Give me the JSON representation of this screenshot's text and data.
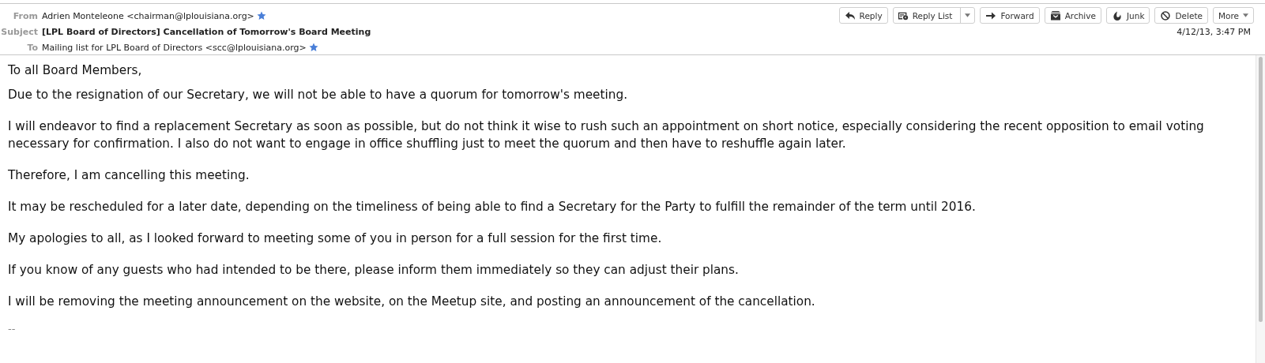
{
  "header": {
    "fields": [
      {
        "label": "From",
        "value": "Adrien Monteleone <chairman@lplouisiana.org>",
        "starred": true,
        "bold": false
      },
      {
        "label": "Subject",
        "value": "[LPL Board of Directors] Cancellation of Tomorrow's Board Meeting",
        "starred": false,
        "bold": true
      },
      {
        "label": "To",
        "value": "Mailing list for LPL Board of Directors <scc@lplouisiana.org>",
        "starred": true,
        "bold": false
      }
    ],
    "buttons": [
      {
        "label": "Reply",
        "kind": "plain"
      },
      {
        "label": "Reply List",
        "kind": "split"
      },
      {
        "label": "Forward",
        "kind": "plain"
      },
      {
        "label": "Archive",
        "kind": "plain"
      },
      {
        "label": "Junk",
        "kind": "plain"
      },
      {
        "label": "Delete",
        "kind": "plain"
      },
      {
        "label": "More",
        "kind": "menu"
      }
    ],
    "date": "4/12/13, 3:47 PM"
  },
  "body": {
    "paragraphs": [
      "To all Board Members,",
      "Due to the resignation of our Secretary, we will not be able to have a quorum for tomorrow's meeting.",
      "I will endeavor to find a replacement Secretary as soon as possible, but do not think it wise to rush such an appointment on short notice, especially considering the recent opposition to email voting necessary for confirmation. I also do not want to engage in office shuffling just to meet the quorum and then have to reshuffle again later.",
      "Therefore, I am cancelling this meeting.",
      "It may be rescheduled for a later date, depending on the timeliness of being able to find a Secretary for the Party to fulfill the remainder of the term until 2016.",
      "My apologies to all, as I looked forward to meeting some of you in person for a full session for the first time.",
      "If you know of any guests who had intended to be there, please inform them immediately so they can adjust their plans.",
      "I will be removing the meeting announcement on the website, on the Meetup site, and posting an announcement of the cancellation."
    ],
    "signature": "--"
  }
}
